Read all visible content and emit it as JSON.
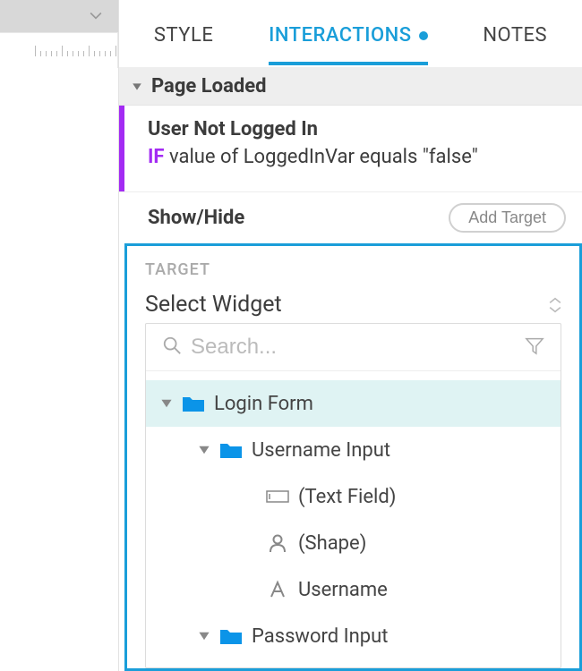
{
  "tabs": {
    "style": "STYLE",
    "interactions": "INTERACTIONS",
    "notes": "NOTES"
  },
  "event": {
    "name": "Page Loaded"
  },
  "case": {
    "name": "User Not Logged In",
    "if_kw": "IF",
    "condition": "value of LoggedInVar equals \"false\""
  },
  "action": {
    "name": "Show/Hide",
    "add_target": "Add Target"
  },
  "target": {
    "label": "TARGET",
    "select": "Select Widget",
    "search_placeholder": "Search..."
  },
  "tree": [
    {
      "label": "Login Form",
      "icon": "folder",
      "indent": 0,
      "expandable": true,
      "selected": true
    },
    {
      "label": "Username Input",
      "icon": "folder",
      "indent": 1,
      "expandable": true
    },
    {
      "label": "(Text Field)",
      "icon": "textfield",
      "indent": 2
    },
    {
      "label": "(Shape)",
      "icon": "shape",
      "indent": 2
    },
    {
      "label": "Username",
      "icon": "text",
      "indent": 2
    },
    {
      "label": "Password Input",
      "icon": "folder",
      "indent": 1,
      "expandable": true
    }
  ]
}
